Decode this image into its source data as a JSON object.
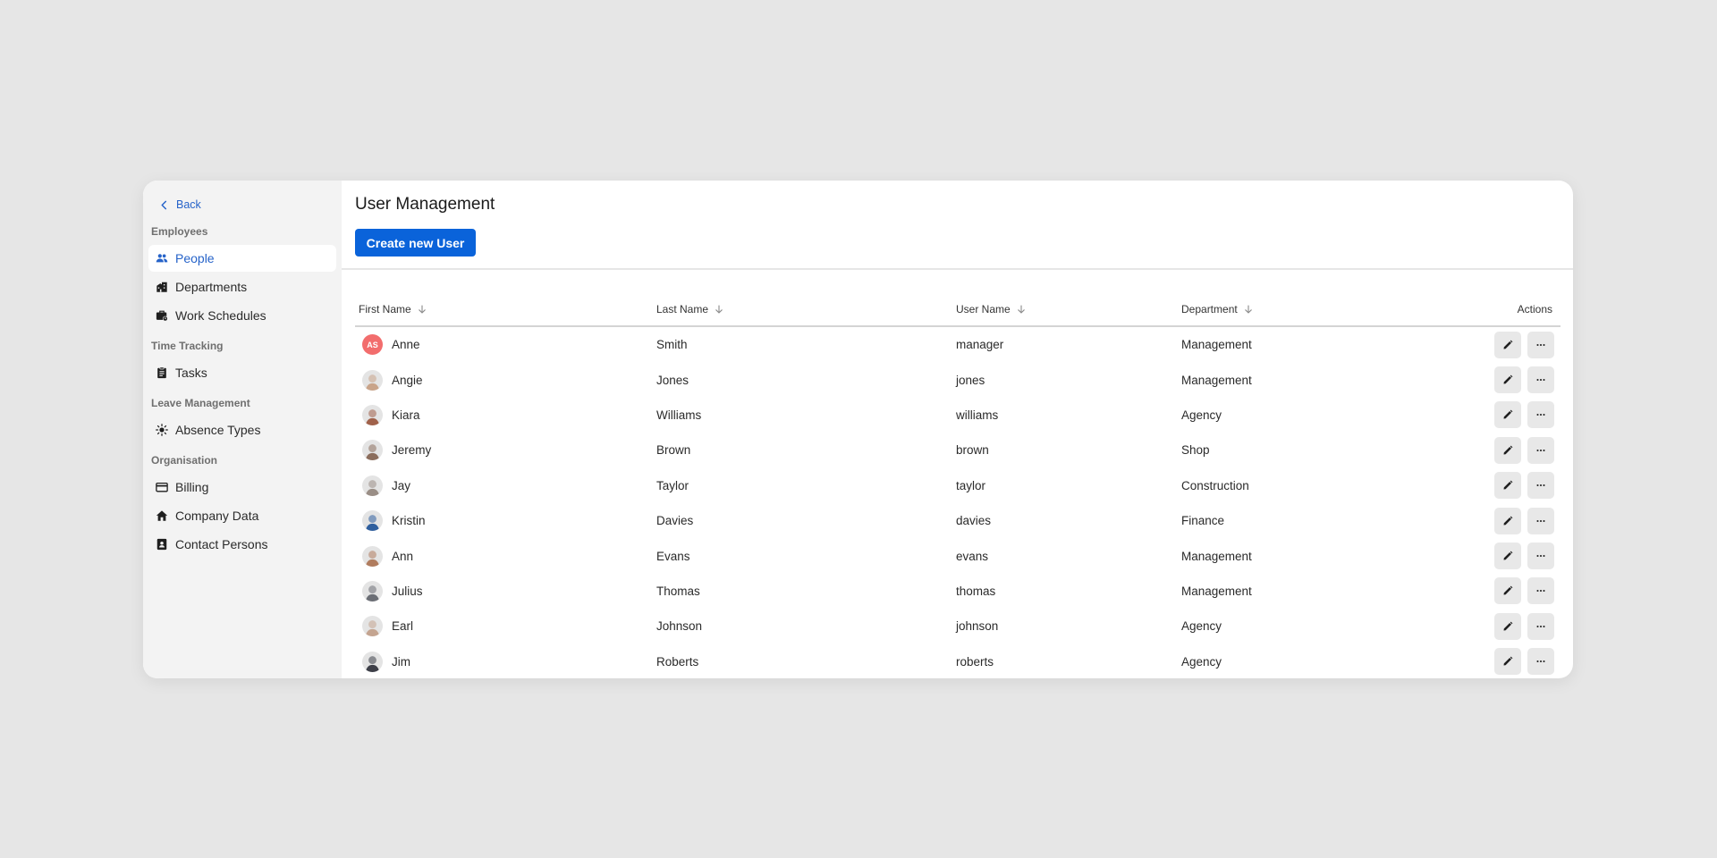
{
  "sidebar": {
    "back_label": "Back",
    "sections": [
      {
        "title": "Employees",
        "items": [
          {
            "label": "People",
            "icon": "people-icon",
            "active": true
          },
          {
            "label": "Departments",
            "icon": "building-icon",
            "active": false
          },
          {
            "label": "Work Schedules",
            "icon": "briefcase-clock-icon",
            "active": false
          }
        ]
      },
      {
        "title": "Time Tracking",
        "items": [
          {
            "label": "Tasks",
            "icon": "clipboard-icon",
            "active": false
          }
        ]
      },
      {
        "title": "Leave Management",
        "items": [
          {
            "label": "Absence Types",
            "icon": "sun-icon",
            "active": false
          }
        ]
      },
      {
        "title": "Organisation",
        "items": [
          {
            "label": "Billing",
            "icon": "credit-card-icon",
            "active": false
          },
          {
            "label": "Company Data",
            "icon": "home-icon",
            "active": false
          },
          {
            "label": "Contact Persons",
            "icon": "contact-icon",
            "active": false
          }
        ]
      }
    ]
  },
  "main": {
    "title": "User Management",
    "create_button_label": "Create new User",
    "table": {
      "headers": {
        "first_name": "First Name",
        "last_name": "Last Name",
        "user_name": "User Name",
        "department": "Department",
        "actions": "Actions"
      },
      "rows": [
        {
          "first": "Anne",
          "last": "Smith",
          "user": "manager",
          "dept": "Management",
          "initials": "AS",
          "avatar_color": "#f26d6d"
        },
        {
          "first": "Angie",
          "last": "Jones",
          "user": "jones",
          "dept": "Management",
          "initials": "",
          "avatar_color": "#c9a48a"
        },
        {
          "first": "Kiara",
          "last": "Williams",
          "user": "williams",
          "dept": "Agency",
          "initials": "",
          "avatar_color": "#a0614a"
        },
        {
          "first": "Jeremy",
          "last": "Brown",
          "user": "brown",
          "dept": "Shop",
          "initials": "",
          "avatar_color": "#8b6d5c"
        },
        {
          "first": "Jay",
          "last": "Taylor",
          "user": "taylor",
          "dept": "Construction",
          "initials": "",
          "avatar_color": "#9a8e86"
        },
        {
          "first": "Kristin",
          "last": "Davies",
          "user": "davies",
          "dept": "Finance",
          "initials": "",
          "avatar_color": "#2f5f9e"
        },
        {
          "first": "Ann",
          "last": "Evans",
          "user": "evans",
          "dept": "Management",
          "initials": "",
          "avatar_color": "#b07c5e"
        },
        {
          "first": "Julius",
          "last": "Thomas",
          "user": "thomas",
          "dept": "Management",
          "initials": "",
          "avatar_color": "#6b6e75"
        },
        {
          "first": "Earl",
          "last": "Johnson",
          "user": "johnson",
          "dept": "Agency",
          "initials": "",
          "avatar_color": "#c4a490"
        },
        {
          "first": "Jim",
          "last": "Roberts",
          "user": "roberts",
          "dept": "Agency",
          "initials": "",
          "avatar_color": "#3d3f48"
        }
      ]
    }
  },
  "colors": {
    "accent": "#0a63da",
    "link": "#2663c9",
    "sidebar_bg": "#f3f3f3",
    "page_bg": "#e6e6e6"
  }
}
